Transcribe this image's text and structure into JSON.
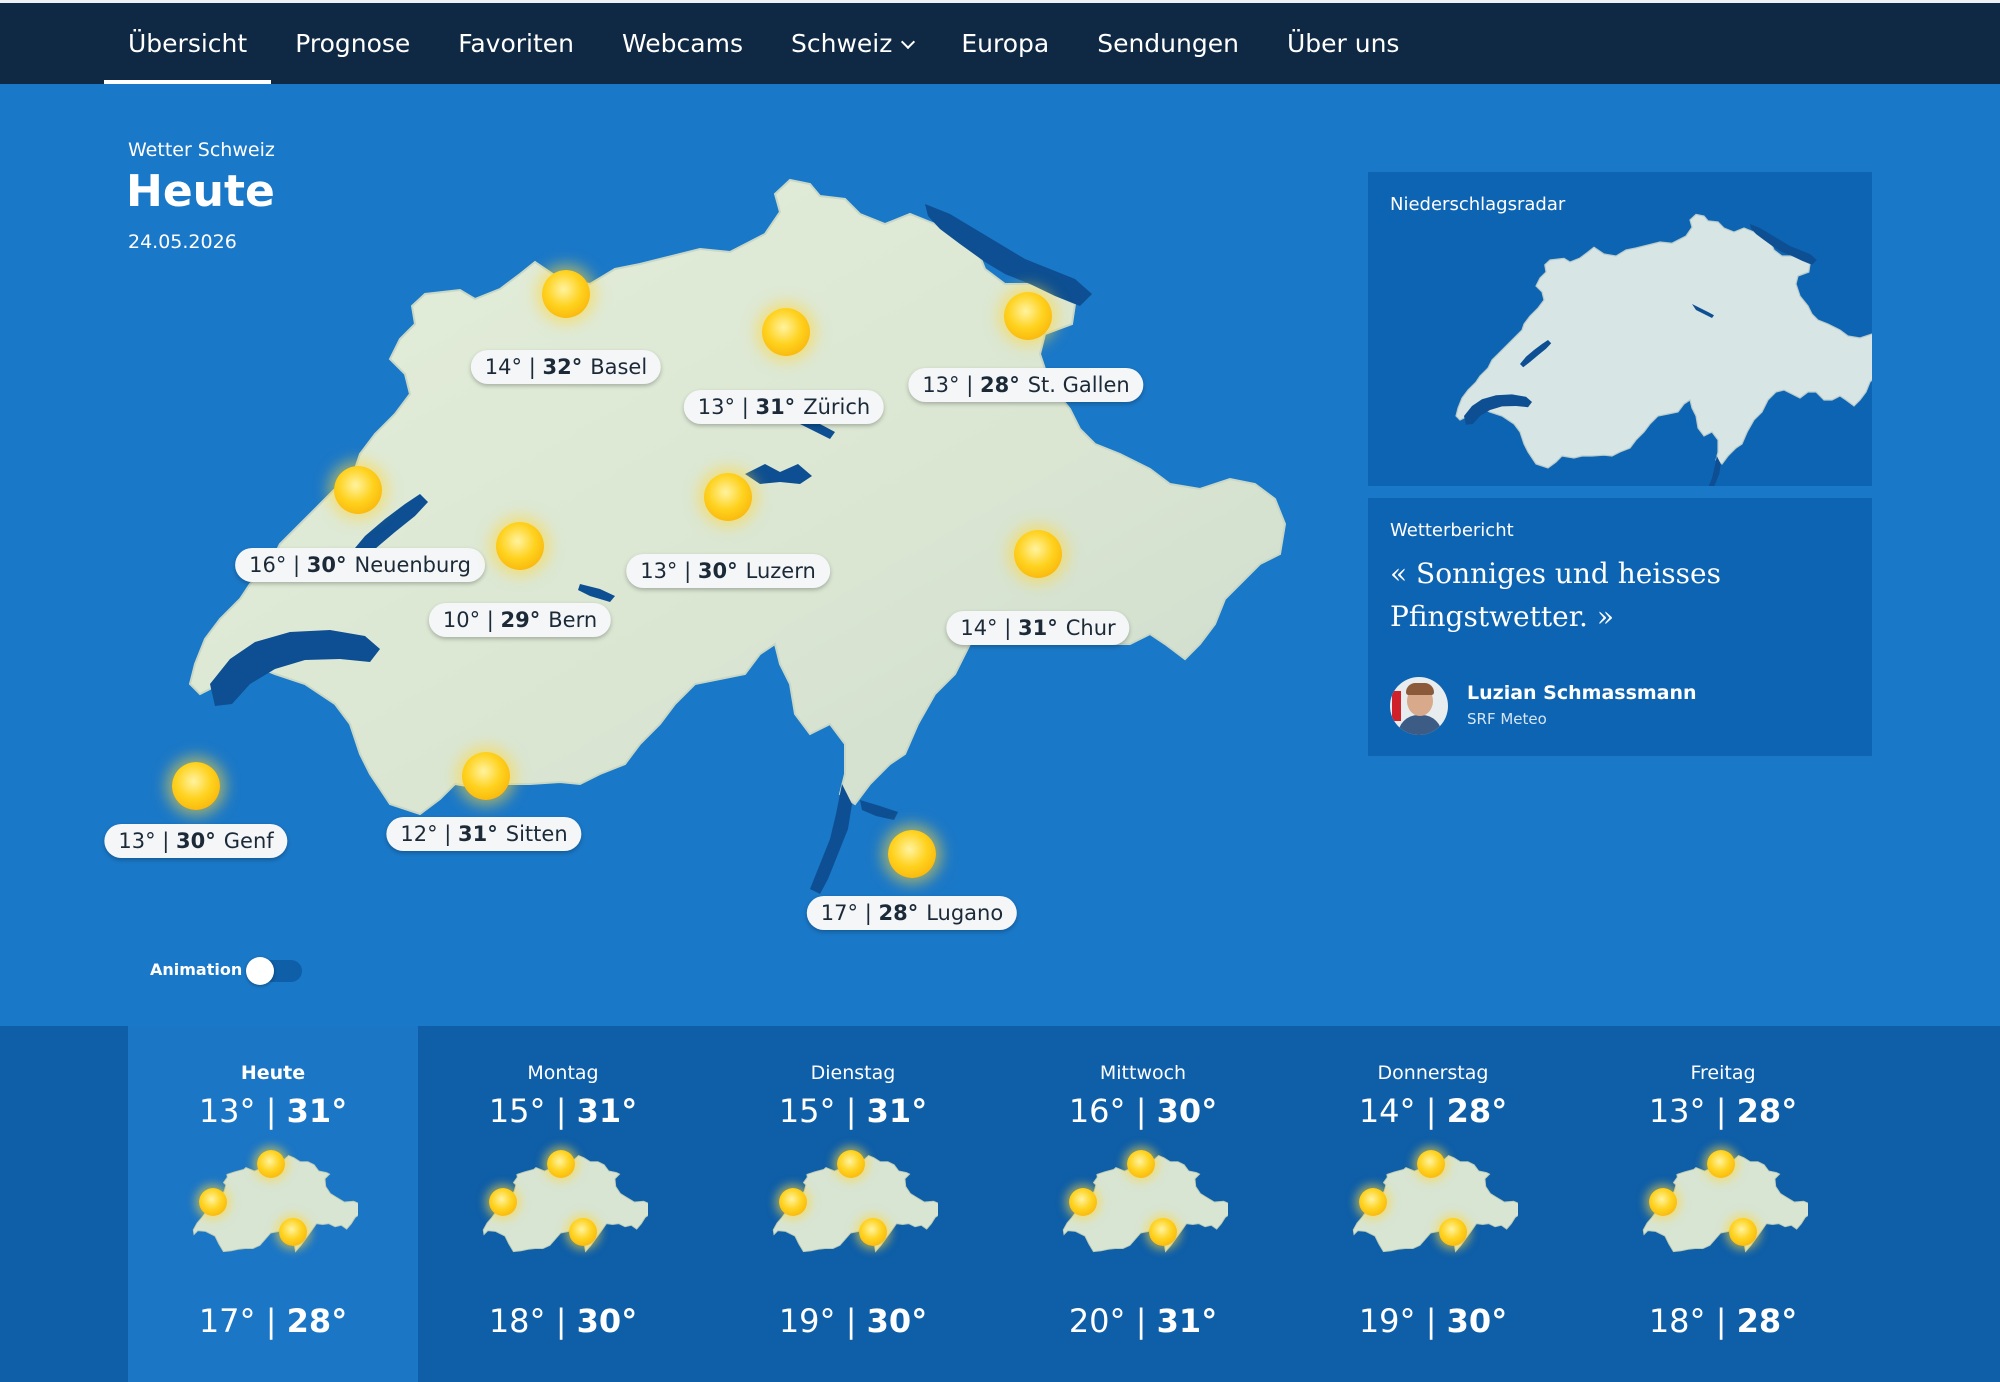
{
  "nav": {
    "items": [
      {
        "label": "Übersicht",
        "active": true
      },
      {
        "label": "Prognose"
      },
      {
        "label": "Favoriten"
      },
      {
        "label": "Webcams"
      },
      {
        "label": "Schweiz",
        "dropdown": true
      },
      {
        "label": "Europa"
      },
      {
        "label": "Sendungen"
      },
      {
        "label": "Über uns"
      }
    ]
  },
  "header": {
    "subtitle": "Wetter Schweiz",
    "title": "Heute",
    "date": "24.05.2026"
  },
  "cities": [
    {
      "name": "Basel",
      "lo": "14°",
      "hi": "32°",
      "icon": "sun-icon"
    },
    {
      "name": "Zürich",
      "lo": "13°",
      "hi": "31°",
      "icon": "sun-icon"
    },
    {
      "name": "St. Gallen",
      "lo": "13°",
      "hi": "28°",
      "icon": "sun-icon"
    },
    {
      "name": "Neuenburg",
      "lo": "16°",
      "hi": "30°",
      "icon": "sun-icon"
    },
    {
      "name": "Luzern",
      "lo": "13°",
      "hi": "30°",
      "icon": "sun-icon"
    },
    {
      "name": "Bern",
      "lo": "10°",
      "hi": "29°",
      "icon": "sun-icon"
    },
    {
      "name": "Chur",
      "lo": "14°",
      "hi": "31°",
      "icon": "sun-icon"
    },
    {
      "name": "Genf",
      "lo": "13°",
      "hi": "30°",
      "icon": "sun-icon"
    },
    {
      "name": "Sitten",
      "lo": "12°",
      "hi": "31°",
      "icon": "sun-icon"
    },
    {
      "name": "Lugano",
      "lo": "17°",
      "hi": "28°",
      "icon": "sun-icon"
    }
  ],
  "animation": {
    "label": "Animation",
    "enabled": false
  },
  "radar": {
    "label": "Niederschlagsradar"
  },
  "report": {
    "label": "Wetterbericht",
    "quote": "« Sonniges und heisses Pfingstwetter. »",
    "author": "Luzian Schmassmann",
    "org": "SRF Meteo"
  },
  "forecast": [
    {
      "day": "Heute",
      "lo": "13°",
      "hi": "31°",
      "lo2": "17°",
      "hi2": "28°",
      "active": true
    },
    {
      "day": "Montag",
      "lo": "15°",
      "hi": "31°",
      "lo2": "18°",
      "hi2": "30°"
    },
    {
      "day": "Dienstag",
      "lo": "15°",
      "hi": "31°",
      "lo2": "19°",
      "hi2": "30°"
    },
    {
      "day": "Mittwoch",
      "lo": "16°",
      "hi": "30°",
      "lo2": "20°",
      "hi2": "31°"
    },
    {
      "day": "Donnerstag",
      "lo": "14°",
      "hi": "28°",
      "lo2": "19°",
      "hi2": "30°"
    },
    {
      "day": "Freitag",
      "lo": "13°",
      "hi": "28°",
      "lo2": "18°",
      "hi2": "28°"
    }
  ],
  "colors": {
    "nav_bg": "#0f2843",
    "main_bg": "#1a78c8",
    "panel_bg": "#0d64b2",
    "strip_bg": "#0e5ea8",
    "land": "#dde9d4",
    "lake": "#0d4f92",
    "sun": "#ffd21e"
  }
}
